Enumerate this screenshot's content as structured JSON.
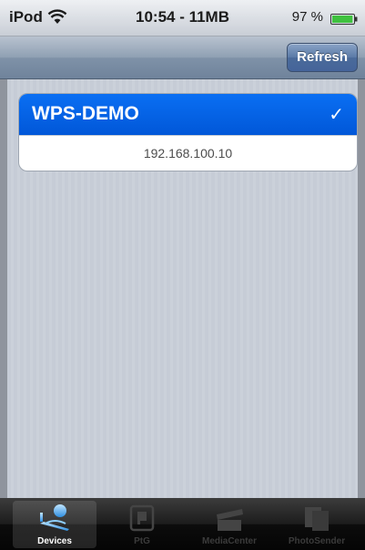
{
  "status_bar": {
    "carrier": "iPod",
    "time": "10:54 - 11MB",
    "battery_percent": "97 %",
    "battery_level": 0.97,
    "wifi_icon": "wifi-icon",
    "battery_icon": "battery-icon"
  },
  "nav_bar": {
    "refresh_label": "Refresh"
  },
  "device_list": {
    "items": [
      {
        "name": "WPS-DEMO",
        "address": "192.168.100.10",
        "selected": true
      }
    ]
  },
  "tab_bar": {
    "tabs": [
      {
        "label": "Devices",
        "icon": "devices-icon",
        "active": true
      },
      {
        "label": "PtG",
        "icon": "ptg-icon",
        "active": false
      },
      {
        "label": "MediaCenter",
        "icon": "media-center-icon",
        "active": false
      },
      {
        "label": "PhotoSender",
        "icon": "photo-sender-icon",
        "active": false
      }
    ]
  },
  "colors": {
    "selection_blue": "#0a6ff3",
    "nav_bar": "#8fa0b3",
    "tab_bar": "#1c1c1c"
  }
}
